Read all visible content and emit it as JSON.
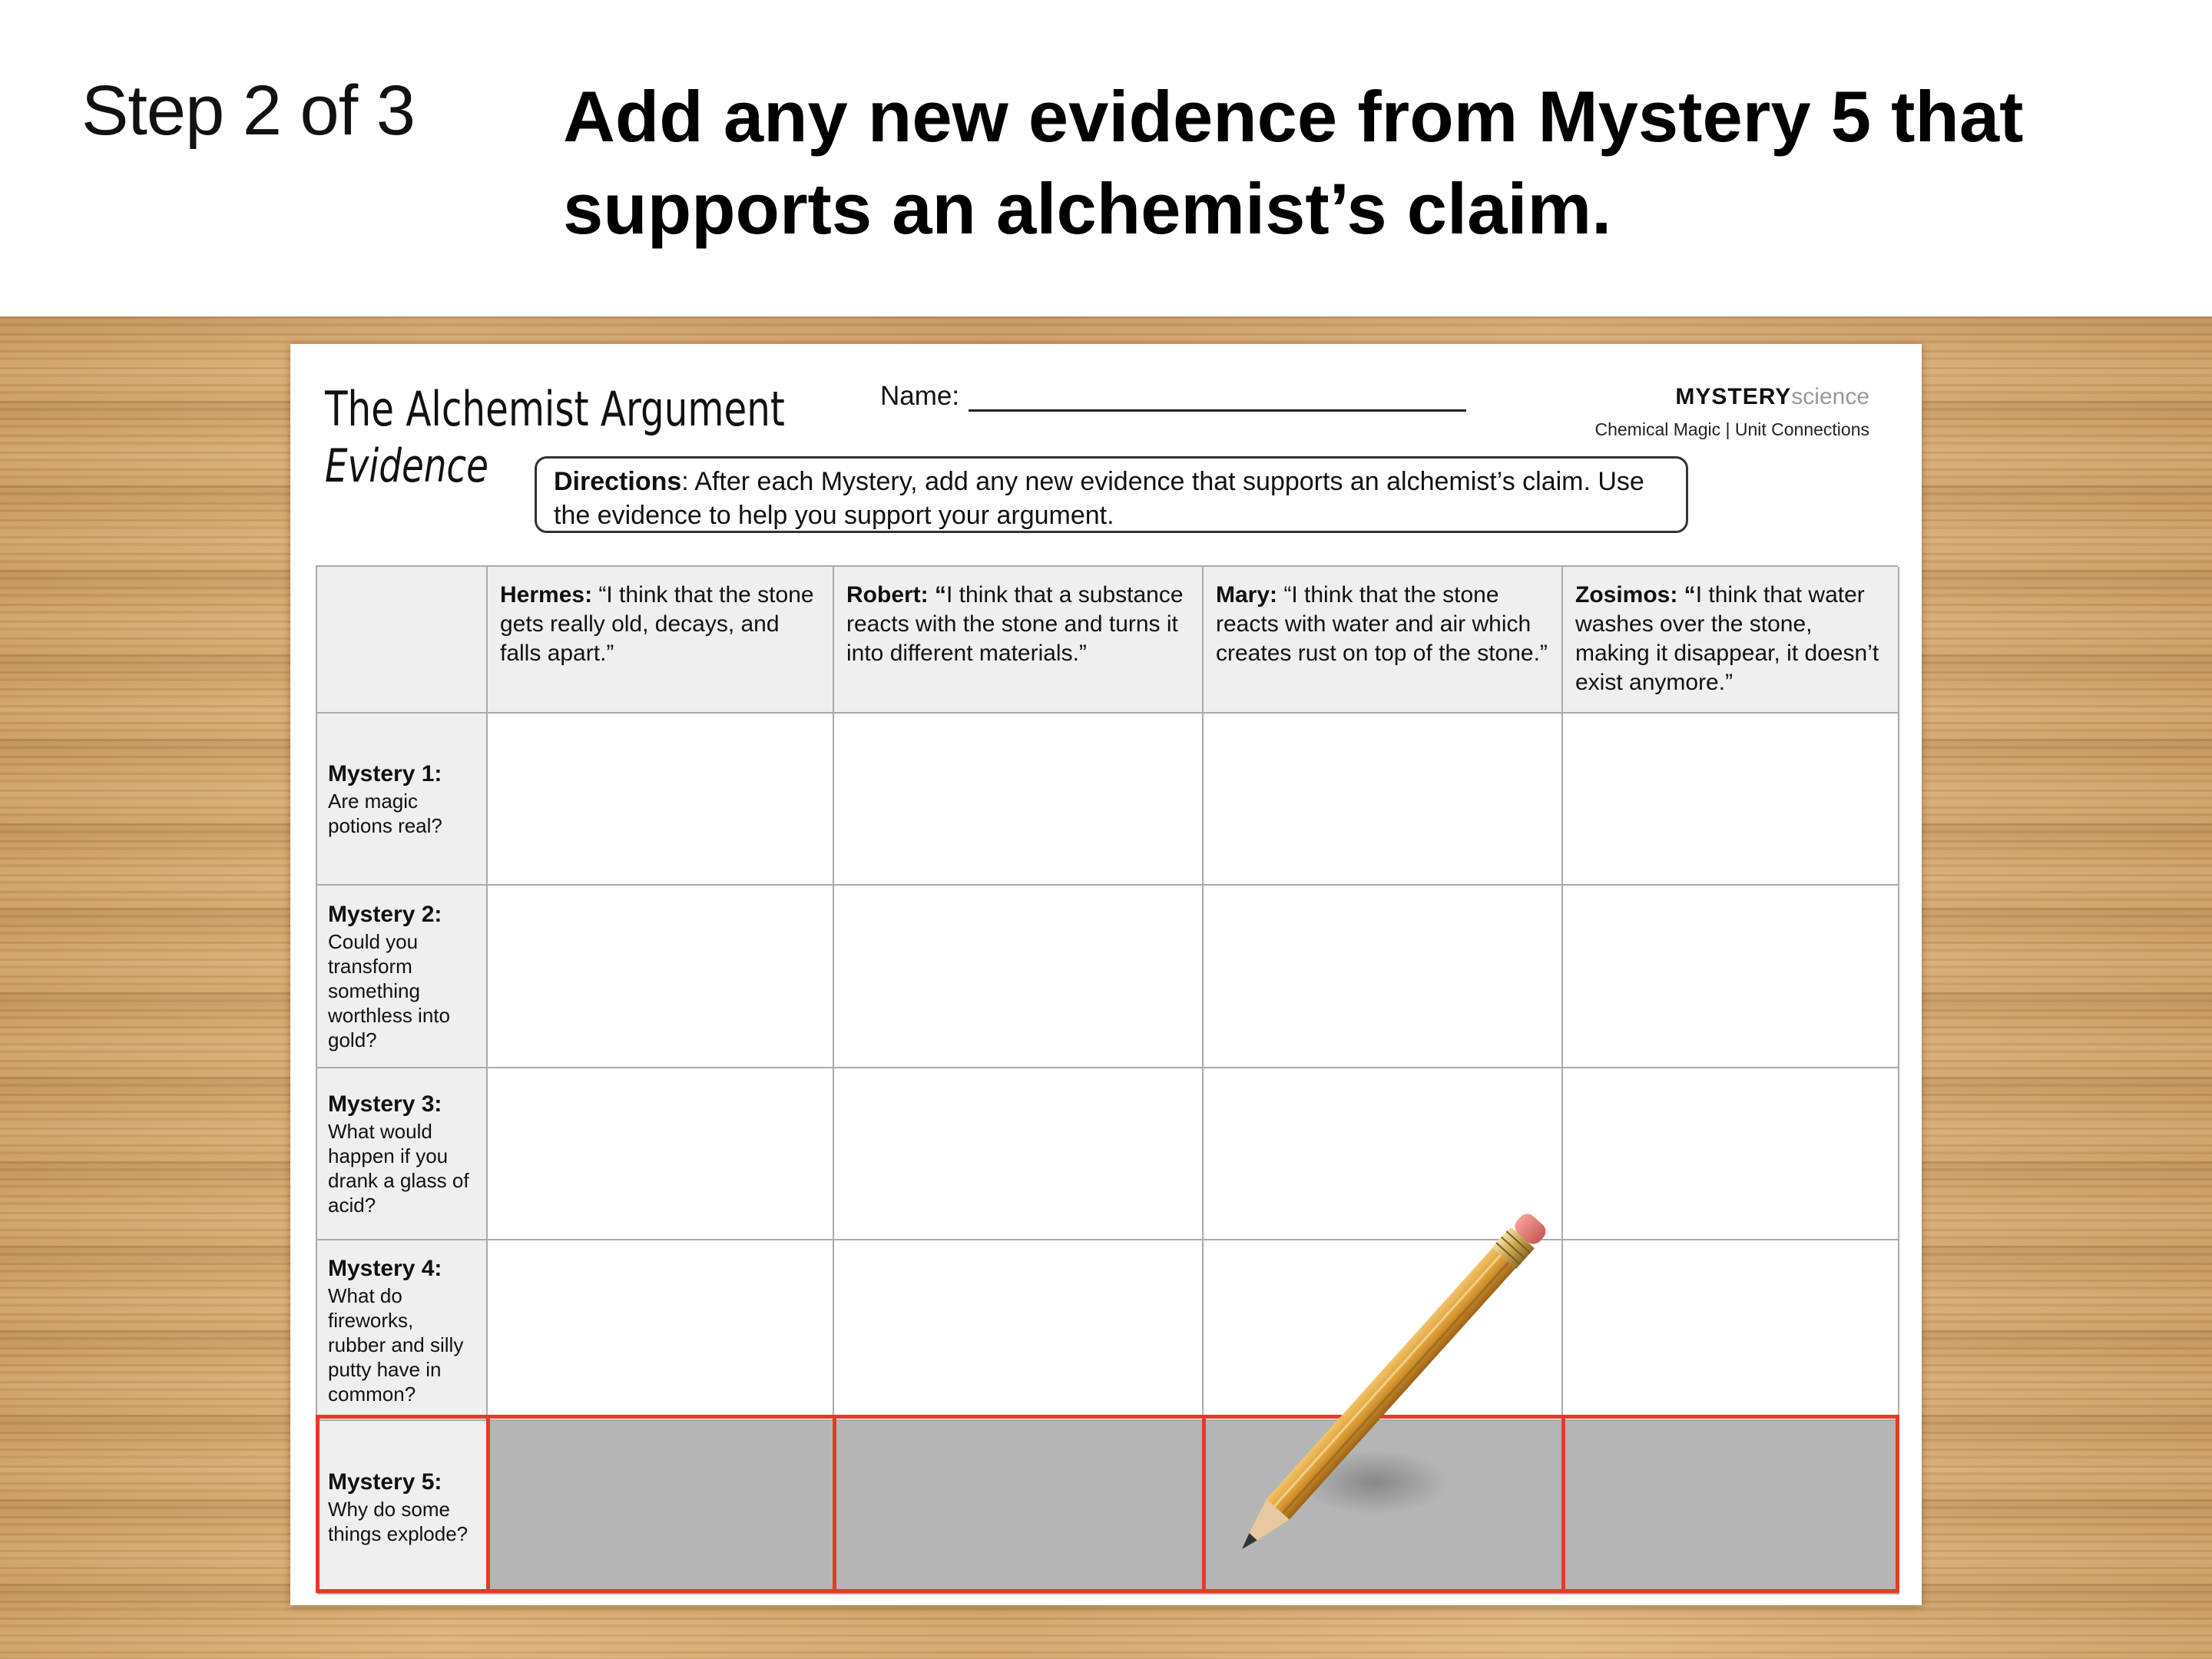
{
  "slide": {
    "step": "Step 2 of 3",
    "instruction_line1": "Add any new evidence from Mystery 5 that",
    "instruction_line2": "supports an alchemist’s claim."
  },
  "worksheet": {
    "title": "The Alchemist Argument",
    "subtitle": "Evidence",
    "name_label": "Name:",
    "brand_bold": "MYSTERY",
    "brand_light": "science",
    "brand_sub": "Chemical Magic | Unit Connections",
    "directions_label": "Directions",
    "directions_text": ": After each Mystery, add any new evidence that supports an alchemist’s claim. Use the evidence to help you support your argument."
  },
  "columns": [
    {
      "name": "Hermes:",
      "quote": " “I think that the stone gets really old, decays, and falls apart.”"
    },
    {
      "name": "Robert: “",
      "quote": "I think that a substance reacts with the stone and turns it into different materials.”"
    },
    {
      "name": "Mary:",
      "quote": " “I think that the stone reacts with water and air which creates rust on top of the stone.”"
    },
    {
      "name": "Zosimos: “",
      "quote": "I think that water washes over the stone, making it disappear, it doesn’t exist anymore.”"
    }
  ],
  "rows": [
    {
      "title": "Mystery 1:",
      "question": "Are magic potions real?"
    },
    {
      "title": "Mystery 2:",
      "question": "Could you transform something worthless into gold?"
    },
    {
      "title": "Mystery 3:",
      "question": "What would happen if you drank a glass of acid?"
    },
    {
      "title": "Mystery 4:",
      "question": "What do fireworks, rubber and silly putty have in common?"
    },
    {
      "title": "Mystery 5:",
      "question": "Why do some things explode?"
    }
  ],
  "colors": {
    "highlight_border": "#e53a2a",
    "highlight_fill": "#b5b5b5",
    "header_fill": "#efefef"
  },
  "icons": [
    "pencil-icon"
  ]
}
